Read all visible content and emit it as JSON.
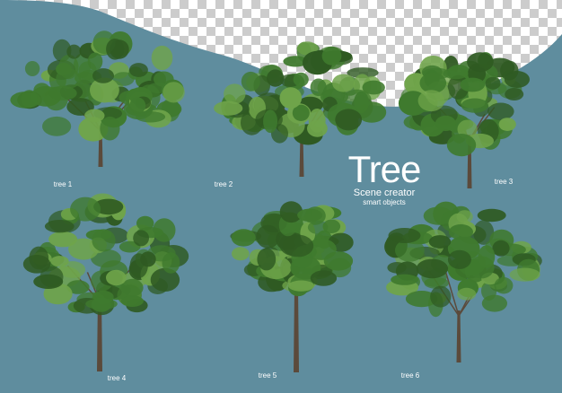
{
  "colors": {
    "background": "#5f8d9e",
    "checker_light": "#ffffff",
    "checker_dark": "#cccccc",
    "foliage_dark": "#2f5a22",
    "foliage_mid": "#3f7a2e",
    "foliage_light": "#6fa44a",
    "trunk": "#5b4a3b",
    "text": "#ffffff"
  },
  "title": {
    "main": "Tree",
    "subtitle": "Scene creator",
    "tagline": "smart objects"
  },
  "trees": [
    {
      "label": "tree 1",
      "icon": "tree-icon"
    },
    {
      "label": "tree 2",
      "icon": "tree-icon"
    },
    {
      "label": "tree 3",
      "icon": "tree-icon"
    },
    {
      "label": "tree 4",
      "icon": "tree-icon"
    },
    {
      "label": "tree 5",
      "icon": "tree-icon"
    },
    {
      "label": "tree 6",
      "icon": "tree-icon"
    }
  ]
}
